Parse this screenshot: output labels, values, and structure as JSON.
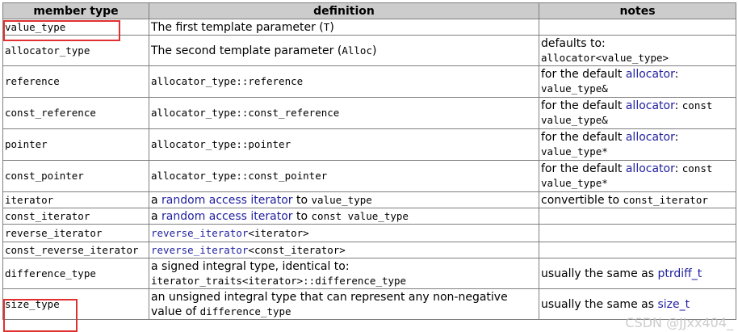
{
  "headers": [
    "member type",
    "definition",
    "notes"
  ],
  "rows": [
    {
      "type": "value_type",
      "def": [
        {
          "t": "The first template parameter (",
          "s": "text"
        },
        {
          "t": "T",
          "s": "mono"
        },
        {
          "t": ")",
          "s": "text"
        }
      ],
      "notes": []
    },
    {
      "type": "allocator_type",
      "def": [
        {
          "t": "The second template parameter (",
          "s": "text"
        },
        {
          "t": "Alloc",
          "s": "mono"
        },
        {
          "t": ")",
          "s": "text"
        }
      ],
      "notes": [
        {
          "t": "defaults to:",
          "s": "text"
        },
        {
          "t": "\n",
          "s": "br"
        },
        {
          "t": "allocator<value_type>",
          "s": "mono"
        }
      ]
    },
    {
      "type": "reference",
      "def": [
        {
          "t": "allocator_type::reference",
          "s": "mono"
        }
      ],
      "notes": [
        {
          "t": "for the default ",
          "s": "text"
        },
        {
          "t": "allocator",
          "s": "link"
        },
        {
          "t": ":",
          "s": "text"
        },
        {
          "t": "\n",
          "s": "br"
        },
        {
          "t": "value_type&",
          "s": "mono"
        }
      ]
    },
    {
      "type": "const_reference",
      "def": [
        {
          "t": "allocator_type::const_reference",
          "s": "mono"
        }
      ],
      "notes": [
        {
          "t": "for the default ",
          "s": "text"
        },
        {
          "t": "allocator",
          "s": "link"
        },
        {
          "t": ": ",
          "s": "text"
        },
        {
          "t": "const",
          "s": "mono"
        },
        {
          "t": "\n",
          "s": "br"
        },
        {
          "t": "value_type&",
          "s": "mono"
        }
      ]
    },
    {
      "type": "pointer",
      "def": [
        {
          "t": "allocator_type::pointer",
          "s": "mono"
        }
      ],
      "notes": [
        {
          "t": "for the default ",
          "s": "text"
        },
        {
          "t": "allocator",
          "s": "link"
        },
        {
          "t": ":",
          "s": "text"
        },
        {
          "t": "\n",
          "s": "br"
        },
        {
          "t": "value_type*",
          "s": "mono"
        }
      ]
    },
    {
      "type": "const_pointer",
      "def": [
        {
          "t": "allocator_type::const_pointer",
          "s": "mono"
        }
      ],
      "notes": [
        {
          "t": "for the default ",
          "s": "text"
        },
        {
          "t": "allocator",
          "s": "link"
        },
        {
          "t": ": ",
          "s": "text"
        },
        {
          "t": "const",
          "s": "mono"
        },
        {
          "t": "\n",
          "s": "br"
        },
        {
          "t": "value_type*",
          "s": "mono"
        }
      ]
    },
    {
      "type": "iterator",
      "def": [
        {
          "t": "a ",
          "s": "text"
        },
        {
          "t": "random access iterator",
          "s": "link"
        },
        {
          "t": " to ",
          "s": "text"
        },
        {
          "t": "value_type",
          "s": "mono"
        }
      ],
      "notes": [
        {
          "t": "convertible to ",
          "s": "text"
        },
        {
          "t": "const_iterator",
          "s": "mono"
        }
      ]
    },
    {
      "type": "const_iterator",
      "def": [
        {
          "t": "a ",
          "s": "text"
        },
        {
          "t": "random access iterator",
          "s": "link"
        },
        {
          "t": " to ",
          "s": "text"
        },
        {
          "t": "const value_type",
          "s": "mono"
        }
      ],
      "notes": []
    },
    {
      "type": "reverse_iterator",
      "def": [
        {
          "t": "reverse_iterator",
          "s": "monolink"
        },
        {
          "t": "<iterator>",
          "s": "mono"
        }
      ],
      "notes": []
    },
    {
      "type": "const_reverse_iterator",
      "def": [
        {
          "t": "reverse_iterator",
          "s": "monolink"
        },
        {
          "t": "<const_iterator>",
          "s": "mono"
        }
      ],
      "notes": []
    },
    {
      "type": "difference_type",
      "def": [
        {
          "t": "a signed integral type, identical to:",
          "s": "text"
        },
        {
          "t": "\n",
          "s": "br"
        },
        {
          "t": "iterator_traits<iterator>::difference_type",
          "s": "mono"
        }
      ],
      "notes": [
        {
          "t": "usually the same as ",
          "s": "text"
        },
        {
          "t": "ptrdiff_t",
          "s": "link"
        }
      ]
    },
    {
      "type": "size_type",
      "def": [
        {
          "t": "an unsigned integral type that can represent any non-negative",
          "s": "text"
        },
        {
          "t": "\n",
          "s": "br"
        },
        {
          "t": "value of ",
          "s": "text"
        },
        {
          "t": "difference_type",
          "s": "mono"
        }
      ],
      "notes": [
        {
          "t": "usually the same as ",
          "s": "text"
        },
        {
          "t": "size_t",
          "s": "link"
        }
      ]
    }
  ],
  "watermark": "CSDN @JJxx404_"
}
